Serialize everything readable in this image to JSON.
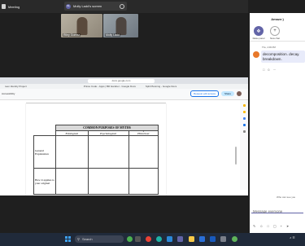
{
  "meeting": {
    "label": "Meeting",
    "screen_share_label": "Molly Ladd's screen",
    "avatar_initials": "ML"
  },
  "participants": [
    {
      "name": "Riley Gomez"
    },
    {
      "name": "Molly Ladd"
    }
  ],
  "browser": {
    "url": "docs.google.com",
    "tabs": [
      "reen Identity Project",
      "Prince Code - Apps | Bill Gardner - Google Docs",
      "Split Planning - Google Docs"
    ]
  },
  "docs": {
    "accessibility_label": "Accessibility",
    "request_edit_label": "Request edit access",
    "share_label": "Share"
  },
  "table": {
    "caption": "COMMON PURPOSES OF MYTHS",
    "columns": [
      "Etiological",
      "Psychological",
      "Historical"
    ],
    "rows": [
      {
        "header": "General Explanation",
        "cells": [
          "",
          "",
          "1"
        ]
      },
      {
        "header": "How it applies to your original",
        "cells": [
          "",
          "",
          ""
        ]
      }
    ]
  },
  "chat": {
    "title": "Amaze:)",
    "actions": [
      {
        "label": "Raise panel",
        "icon": "shield-icon"
      },
      {
        "label": "New chat",
        "icon": "plus-icon"
      }
    ],
    "message_time": "Thu, 4:09 PM",
    "message_text": "decomposition. decay. breakdown.",
    "who_can_see": "Who can see you",
    "compose_placeholder": "Message everyone"
  },
  "taskbar": {
    "search_label": "Search",
    "icons": [
      "weather-icon",
      "files-icon",
      "chrome-icon",
      "edge-icon",
      "teams-icon",
      "outlook-icon",
      "explorer-icon",
      "store-icon",
      "word-icon",
      "app-icon"
    ]
  },
  "colors": {
    "teams_accent": "#6264a7",
    "bubble_bg": "#e8ebfa",
    "taskbar_bg": "#202a3a"
  }
}
